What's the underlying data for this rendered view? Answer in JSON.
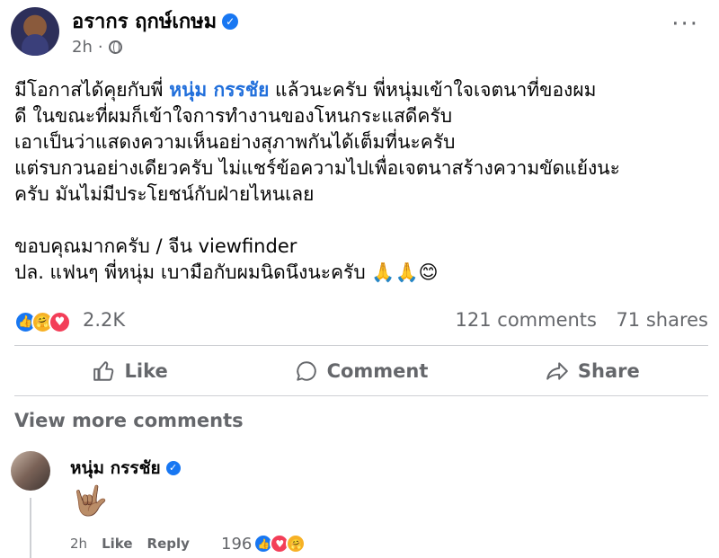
{
  "post": {
    "author": "อรากร ฤกษ์เกษม",
    "time": "2h",
    "privacy_dot": "·",
    "more_label": "···",
    "body_line1_pre": "มีโอกาสได้คุยกับพี่ ",
    "body_line1_mention": "หนุ่ม กรรชัย",
    "body_line1_post": " แล้วนะครับ พี่หนุ่มเข้าใจเจตนาที่ของผม",
    "body_line2": "ดี ในขณะที่ผมก็เข้าใจการทำงานของโหนกระแสดีครับ",
    "body_line3": "เอาเป็นว่าแสดงความเห็นอย่างสุภาพกันได้เต็มที่นะครับ",
    "body_line4": "แต่รบกวนอย่างเดียวครับ ไม่แชร์ข้อความไปเพื่อเจตนาสร้างความขัดแย้งนะ",
    "body_line5": "ครับ มันไม่มีประโยชน์กับฝ่ายไหนเลย",
    "body_line6": "ขอบคุณมากครับ / จีน viewfinder",
    "body_line7": "ปล. แฟนๆ พี่หนุ่ม เบามือกับผมนิดนึงนะครับ 🙏🙏😊"
  },
  "stats": {
    "reaction_count": "2.2K",
    "comments": "121 comments",
    "shares": "71 shares"
  },
  "actions": {
    "like": "Like",
    "comment": "Comment",
    "share": "Share"
  },
  "view_more_comments": "View more comments",
  "comment": {
    "author": "หนุ่ม กรรชัย",
    "emoji": "🤟🏽",
    "time": "2h",
    "like": "Like",
    "reply": "Reply",
    "reaction_count": "196"
  },
  "colors": {
    "accent": "#1877f2",
    "mention": "#216fdb",
    "secondary_text": "#65676b"
  }
}
